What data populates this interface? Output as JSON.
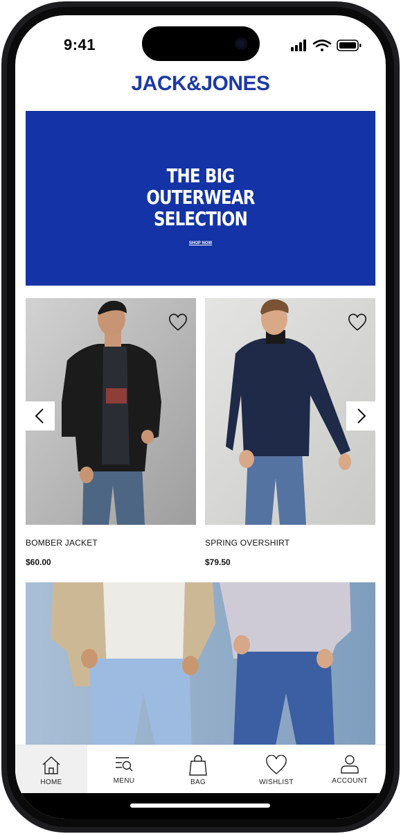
{
  "status_bar": {
    "time": "9:41"
  },
  "brand": {
    "logo_text": "JACK&JONES",
    "color": "#1d3aa7"
  },
  "banner": {
    "title_lines": [
      "THE BIG",
      "OUTERWEAR",
      "SELECTION"
    ],
    "cta": "SHOP NOW",
    "background": "#1333a6"
  },
  "products": [
    {
      "name": "BOMBER JACKET",
      "price": "$60.00"
    },
    {
      "name": "SPRING OVERSHIRT",
      "price": "$79.50"
    }
  ],
  "tabbar": {
    "items": [
      {
        "label": "HOME",
        "icon": "home-icon",
        "active": true
      },
      {
        "label": "MENU",
        "icon": "menu-search-icon",
        "active": false
      },
      {
        "label": "BAG",
        "icon": "bag-icon",
        "active": false
      },
      {
        "label": "WISHLIST",
        "icon": "heart-icon",
        "active": false
      },
      {
        "label": "ACCOUNT",
        "icon": "account-icon",
        "active": false
      }
    ]
  }
}
